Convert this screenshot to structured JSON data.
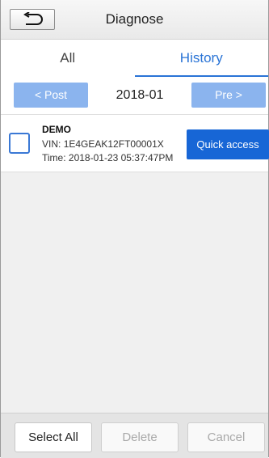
{
  "header": {
    "title": "Diagnose",
    "back_icon": "back-arrow-icon"
  },
  "tabs": [
    {
      "label": "All",
      "active": false
    },
    {
      "label": "History",
      "active": true
    }
  ],
  "date_nav": {
    "prev_label": "< Post",
    "current": "2018-01",
    "next_label": "Pre >"
  },
  "records": [
    {
      "name": "DEMO",
      "vin_label": "VIN:",
      "vin": "1E4GEAK12FT00001X",
      "time_label": "Time:",
      "time": "2018-01-23 05:37:47PM",
      "action_label": "Quick access"
    }
  ],
  "footer": {
    "select_all": "Select All",
    "delete": "Delete",
    "cancel": "Cancel"
  },
  "colors": {
    "accent": "#2a74d6",
    "nav_button": "#8bb4ee",
    "quick_access": "#1766d6"
  }
}
